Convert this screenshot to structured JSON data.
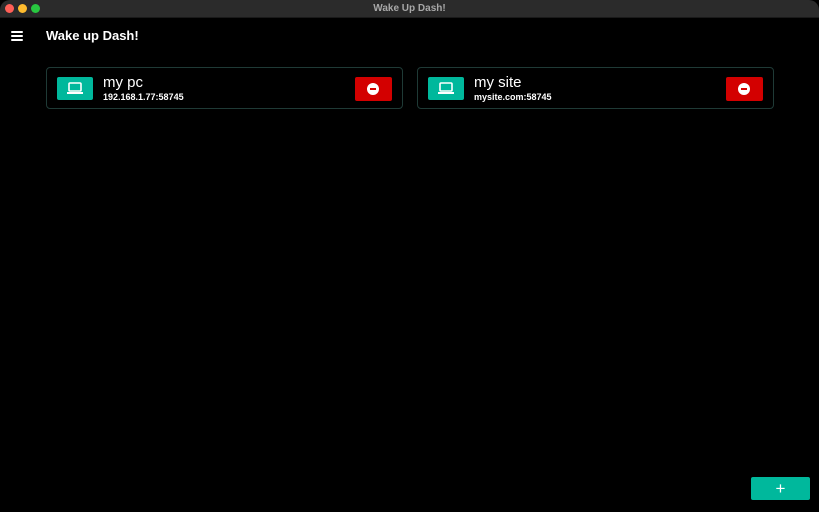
{
  "window": {
    "title": "Wake Up Dash!"
  },
  "header": {
    "title": "Wake up Dash!",
    "menu_icon": "hamburger-icon"
  },
  "devices": [
    {
      "name": "my pc",
      "address": "192.168.1.77:58745",
      "icon": "laptop-icon"
    },
    {
      "name": "my site",
      "address": "mysite.com:58745",
      "icon": "laptop-icon"
    }
  ],
  "actions": {
    "add_label": "+"
  },
  "colors": {
    "accent": "#00b89c",
    "danger": "#d30000",
    "background": "#000000"
  }
}
